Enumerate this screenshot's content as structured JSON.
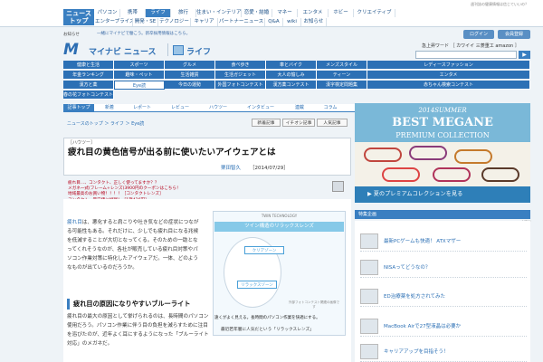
{
  "header": {
    "small_note": "週刊誌の健康情報は信じていいの？",
    "logo_line1": "ニュース",
    "logo_line2": "トップ",
    "nav_row1": [
      "パソコン",
      "携帯",
      "ライフ",
      "旅行",
      "住まい・インテリア",
      "恋愛・結婚",
      "マネー",
      "エンタメ",
      "ホビー",
      "クリエイティブ"
    ],
    "nav_row2": [
      "エンタープライズ",
      "開発・SE",
      "テクノロジー",
      "キャリア",
      "パートナーニュース",
      "Q&A",
      "wiki",
      "お知らせ"
    ],
    "sub_notice": "お知らせ",
    "slogan": "一緒にマイナビで働こう。新卒採用情報はこちら。",
    "login_label": "ログイン",
    "register_label": "会員登録",
    "brand_mark": "M",
    "brand_name": "マイナビ ニュース",
    "section_name": "ライフ",
    "search_label": "急上昇ワード ［ カワイイ 三菱重工 amazon ］",
    "search_button": "▶"
  },
  "categories": {
    "row1": [
      "健康と生活",
      "スポーツ",
      "グルメ",
      "食べ歩き",
      "車とバイク",
      "メンズスタイル",
      "レディースファッション"
    ],
    "row2": [
      "年金ランキング",
      "趣味・ペット",
      "生活雑貨",
      "生活ガジェット",
      "大人の愉しみ",
      "ティーン",
      "エンタメ"
    ],
    "row3": [
      "漢方と薬",
      "Eye読",
      "今日の運勢",
      "外国フォトコンテスト",
      "漢方薬コンテスト",
      "漢字検定問題集",
      "赤ちゃん検索コンテスト"
    ],
    "row4": [
      "春の花フォトコンテスト"
    ],
    "selected": "Eye読"
  },
  "subtabs": [
    "記事トップ",
    "新着",
    "レポート",
    "レビュー",
    "ハウツー",
    "インタビュー",
    "連載",
    "コラム"
  ],
  "breadcrumb": "ニュースのトップ ＞ ライフ ＞ Eye読",
  "tags": [
    "新着記事",
    "イチオシ記事",
    "人気記事"
  ],
  "article": {
    "kicker": "［ハウツー］",
    "headline": "疲れ目の黄色信号が出る前に使いたいアイウェアとは",
    "author": "栗田智久",
    "date": "［2014/07/29］",
    "promo_links": [
      "疲れ目…、コンタクト、正しく使ってますか？？",
      "メガネ一式(フレーム+レンズ)3900円のクーポンはこちら！",
      "地域最高のお買い物！！！！［コンタクトレンズ］",
      "コンタクト、最安値に挑戦！［1箱426円］"
    ],
    "body1": "疲れ目は、悪化すると肩こりや吐き気などの症状につながる可能性もある。それだけに、少しでも疲れ目になる兆候を低減することが大切となってくる。そのための一助となってくれそうなのが、各社が販売している疲れ目対策やパソコン作業対策に特化したアイウェアだ。一体、どのようなものが出ているのだろうか。",
    "body1_lead": "疲れ目",
    "section_heading": "疲れ目の原因になりやすいブルーライト",
    "body2": "疲れ目の最大の原因として挙げられるのは、長時間のパソコン使用だろう。パソコン作業に伴う目の負担を減らすために注目を浴びたのが、近年よく耳にするようになった「ブルーライト対応」のメガネだ。"
  },
  "ad": {
    "top_label": "TWIN TECHNOLOGY",
    "band": "ツイン構造のリラックスレンズ",
    "zone_a": "クリアゾーン",
    "zone_b": "リラックスゾーン",
    "note": "外部フォトコンテスト関連の画像です",
    "caption": "遠くがよく見える。長時間のパソコン作業を快適にする。",
    "footer": "最近若年層に人気だという「リラックスレンズ」"
  },
  "banner": {
    "year": "2014SUMMER",
    "title": "BEST MEGANE",
    "subtitle": "PREMIUM COLLECTION",
    "footer": "▶ 夏のプレミアムコレクションを見る"
  },
  "sidebar": {
    "heading": "特集企画",
    "new_label": "NEW",
    "items": [
      "最新PCゲームも快適！ ATXマザー",
      "NISAってどうなの？",
      "ED治療薬を処方されてみた",
      "MacBook Airで27型液晶は必要か",
      "キャリアアップを目指そう！"
    ]
  }
}
